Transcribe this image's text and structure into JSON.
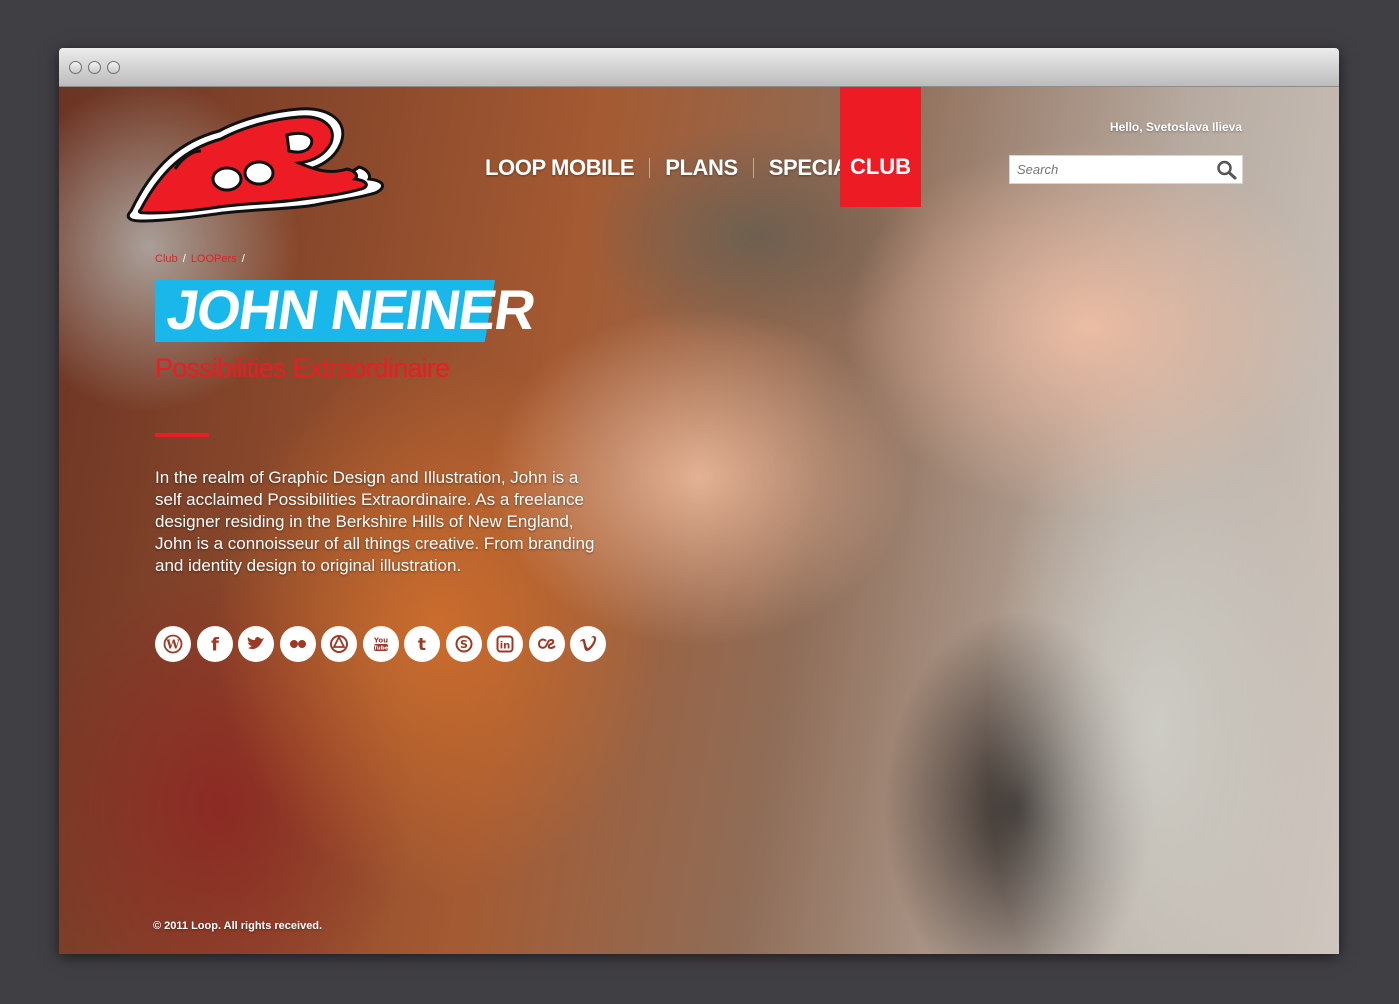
{
  "site": {
    "logo_text": "LooP"
  },
  "nav": {
    "items": [
      {
        "label": "LOOP MOBILE"
      },
      {
        "label": "PLANS"
      },
      {
        "label": "SPECIALS"
      }
    ],
    "active": {
      "label": "CLUB"
    }
  },
  "user": {
    "greeting": "Hello, Svetoslava Ilieva"
  },
  "search": {
    "placeholder": "Search"
  },
  "breadcrumb": {
    "items": [
      "Club",
      "LOOPers"
    ],
    "separator": "/"
  },
  "profile": {
    "name": "JOHN NEINER",
    "title": "Possibilities Extraordinaire",
    "bio": "In the realm of Graphic Design and Illustration, John is a self acclaimed Possibilities Extraordinaire. As a freelance designer residing in the Berkshire Hills of New England, John is a connoisseur of all things creative. From branding and identity design to original illustration."
  },
  "social": [
    {
      "icon": "wordpress-icon"
    },
    {
      "icon": "facebook-icon"
    },
    {
      "icon": "twitter-icon"
    },
    {
      "icon": "flickr-icon"
    },
    {
      "icon": "picasa-icon"
    },
    {
      "icon": "youtube-icon",
      "text": "You Tube"
    },
    {
      "icon": "tumblr-icon"
    },
    {
      "icon": "skype-icon"
    },
    {
      "icon": "linkedin-icon"
    },
    {
      "icon": "lastfm-icon"
    },
    {
      "icon": "vimeo-icon"
    }
  ],
  "footer": {
    "copyright": "© 2011 Loop. All rights received."
  },
  "colors": {
    "brand_red": "#ec1b24",
    "accent_blue": "#1ab7ea",
    "background": "#403f44"
  }
}
